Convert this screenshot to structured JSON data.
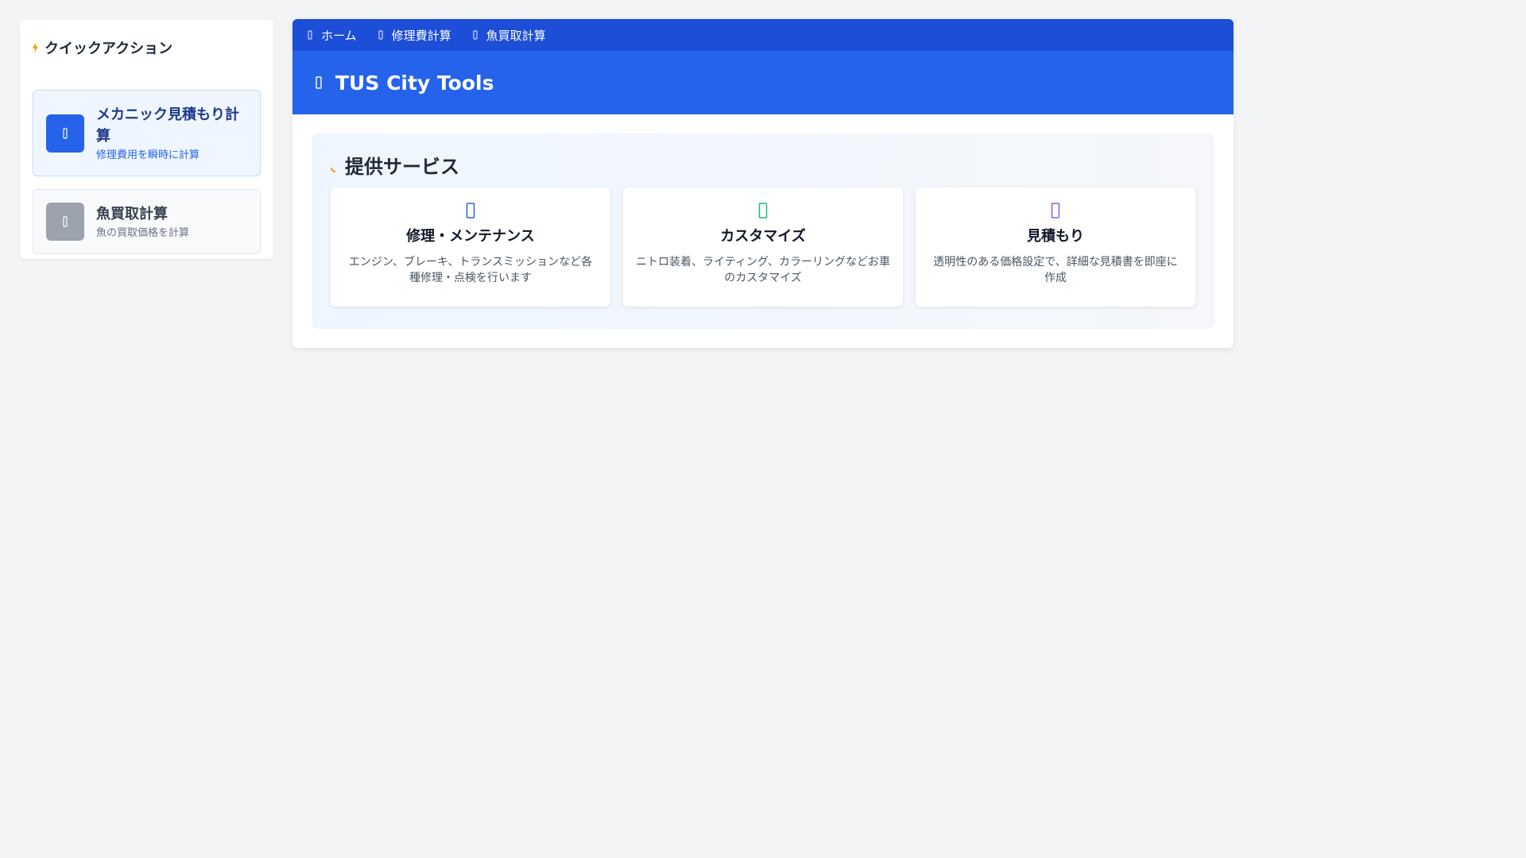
{
  "sidebar": {
    "title": "クイックアクション",
    "title_icon": "bolt-icon",
    "actions": [
      {
        "name": "メカニック見積もり計算",
        "desc": "修理費用を瞬時に計算",
        "icon": "calculator-icon",
        "active": true
      },
      {
        "name": "魚買取計算",
        "desc": "魚の買取価格を計算",
        "icon": "fish-icon",
        "active": false
      }
    ]
  },
  "nav": {
    "items": [
      {
        "label": "ホーム",
        "icon": "home-icon"
      },
      {
        "label": "修理費計算",
        "icon": "calculator-icon"
      },
      {
        "label": "魚買取計算",
        "icon": "fish-icon"
      }
    ]
  },
  "header": {
    "title": "TUS City Tools",
    "icon": "tools-icon"
  },
  "services": {
    "title": "提供サービス",
    "title_icon": "sparkle-icon",
    "cards": [
      {
        "name": "修理・メンテナンス",
        "desc": "エンジン、ブレーキ、トランスミッションなど各種修理・点検を行います",
        "icon": "wrench-icon",
        "color": "#2563eb"
      },
      {
        "name": "カスタマイズ",
        "desc": "ニトロ装着、ライティング、カラーリングなどお車のカスタマイズ",
        "icon": "paint-icon",
        "color": "#10b981"
      },
      {
        "name": "見積もり",
        "desc": "透明性のある価格設定で、詳細な見積書を即座に作成",
        "icon": "document-icon",
        "color": "#8b5cf6"
      }
    ]
  },
  "colors": {
    "accent": "#2563eb",
    "nav_bg": "#1d4ed8",
    "background": "#f3f4f6",
    "highlight": "#f59e0b"
  }
}
